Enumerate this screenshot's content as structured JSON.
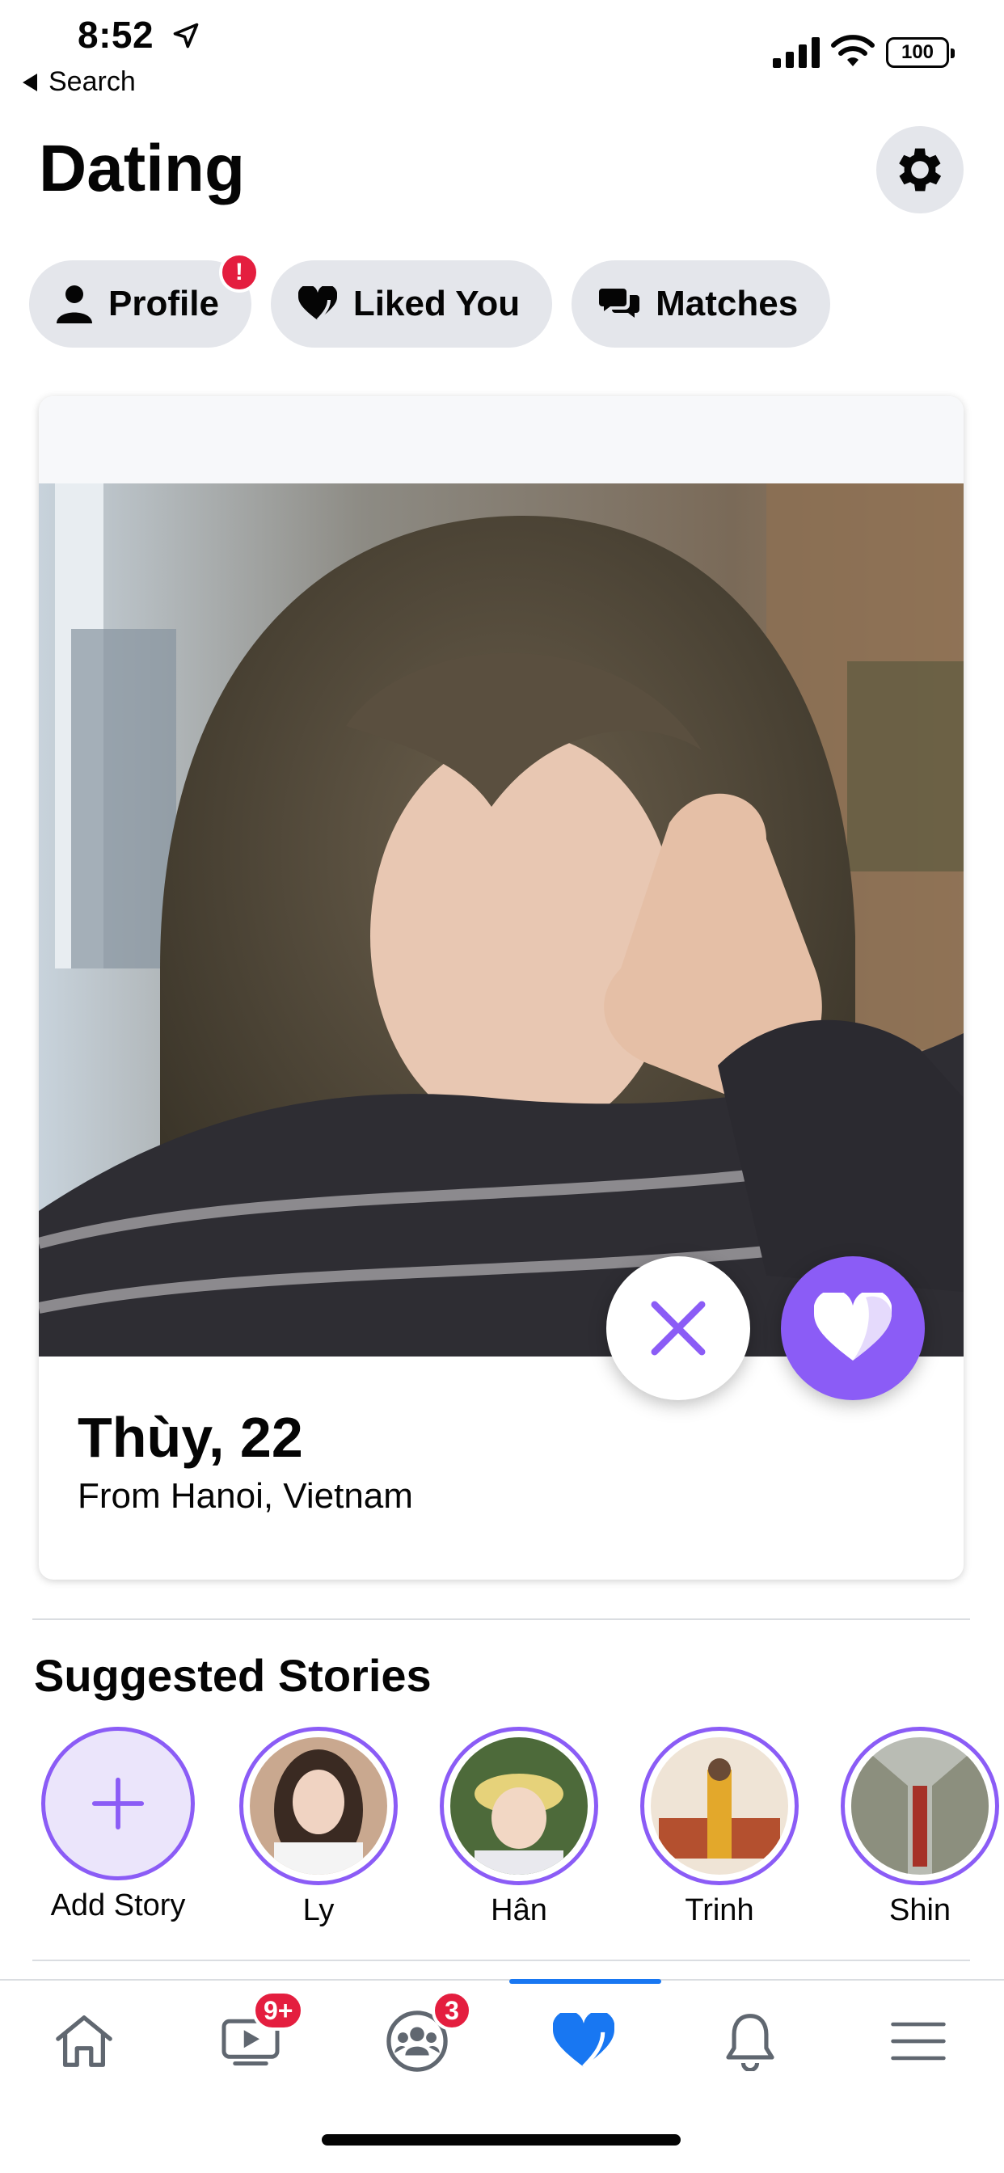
{
  "status_bar": {
    "time": "8:52",
    "back_label": "Search",
    "battery": "100"
  },
  "header": {
    "title": "Dating"
  },
  "tabs": [
    {
      "label": "Profile",
      "badge": "!"
    },
    {
      "label": "Liked You"
    },
    {
      "label": "Matches"
    }
  ],
  "profile_card": {
    "name_age": "Thùy, 22",
    "location": "From Hanoi, Vietnam"
  },
  "stories": {
    "title": "Suggested Stories",
    "items": [
      {
        "label": "Add Story"
      },
      {
        "label": "Ly"
      },
      {
        "label": "Hân"
      },
      {
        "label": "Trinh"
      },
      {
        "label": "Shin"
      }
    ]
  },
  "bottom_nav": {
    "watch_badge": "9+",
    "groups_badge": "3",
    "active": "dating"
  },
  "colors": {
    "accent_purple": "#8b5cf6",
    "facebook_blue": "#1877f2",
    "badge_red": "#e41e3f",
    "pill_gray": "#e4e6eb"
  }
}
